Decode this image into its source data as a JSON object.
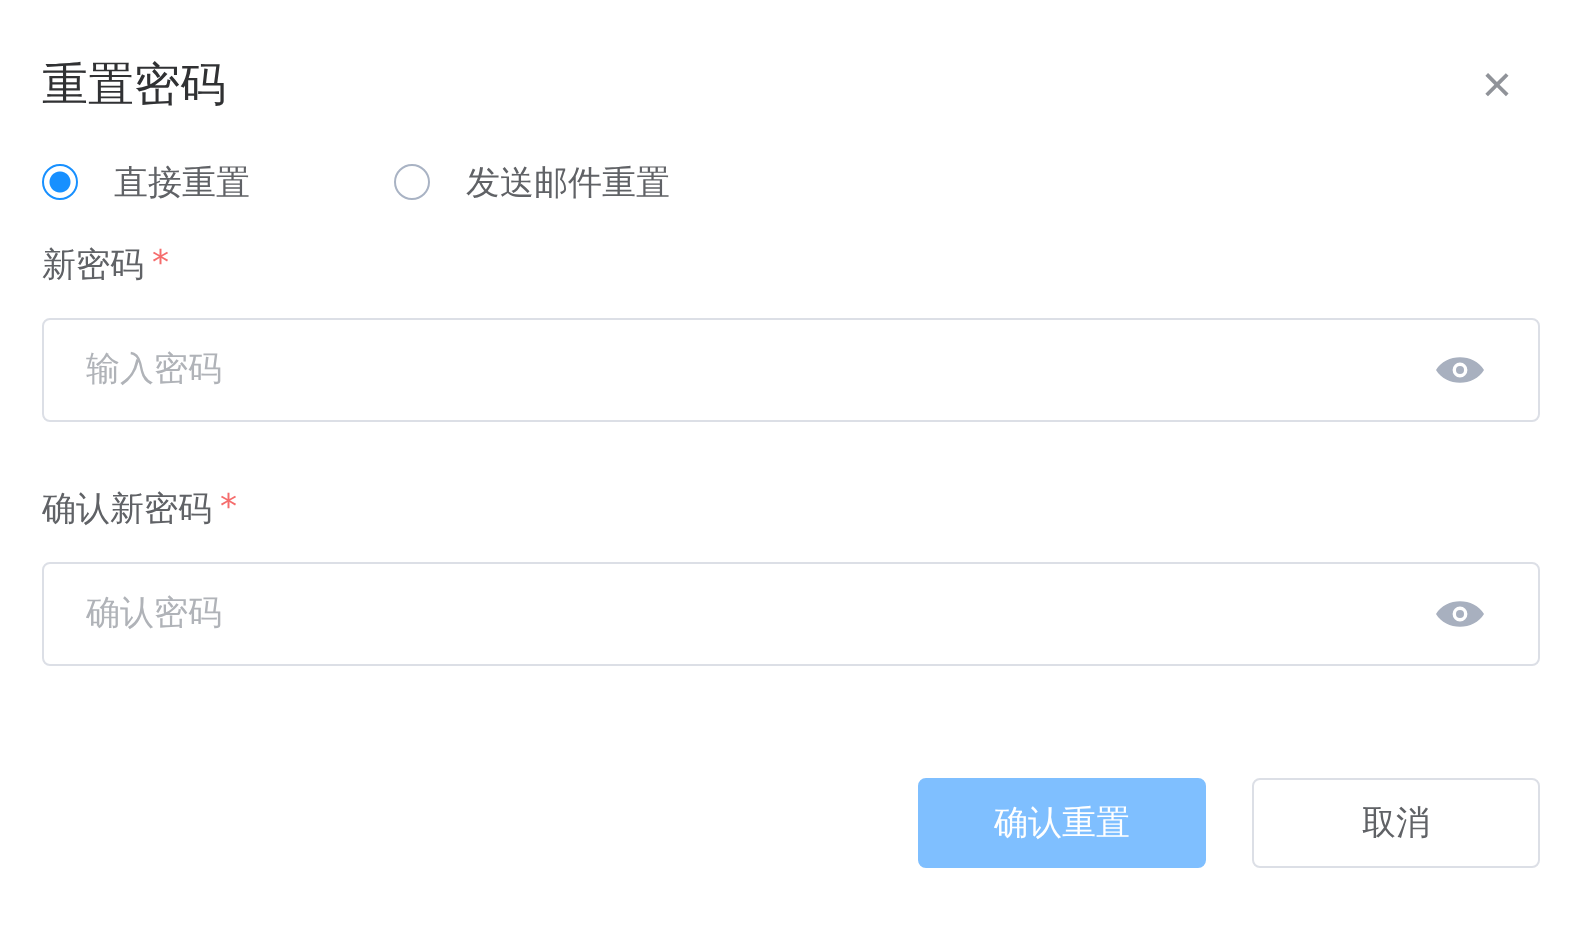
{
  "dialog": {
    "title": "重置密码",
    "close_icon": "×"
  },
  "reset_modes": [
    {
      "label": "直接重置",
      "selected": true
    },
    {
      "label": "发送邮件重置",
      "selected": false
    }
  ],
  "fields": [
    {
      "label": "新密码",
      "required": true,
      "required_mark": "*",
      "placeholder": "输入密码"
    },
    {
      "label": "确认新密码",
      "required": true,
      "required_mark": "*",
      "placeholder": "确认密码"
    }
  ],
  "buttons": [
    {
      "label": "确认重置",
      "kind": "primary",
      "disabled": true
    },
    {
      "label": "取消",
      "kind": "default",
      "disabled": false
    }
  ]
}
